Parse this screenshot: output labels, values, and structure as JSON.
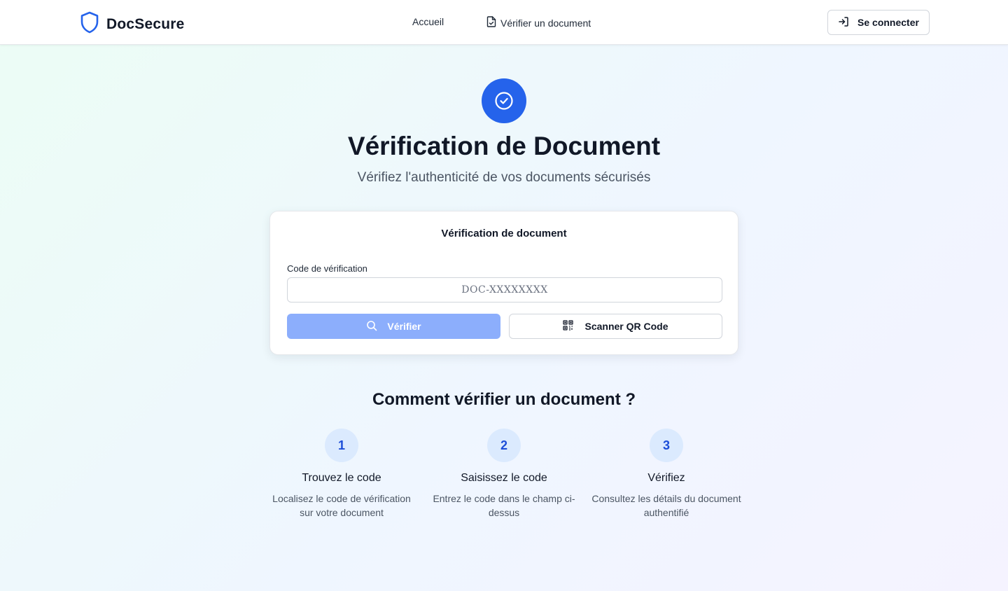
{
  "header": {
    "brand": "DocSecure",
    "nav": {
      "home": "Accueil",
      "verify": "Vérifier un document"
    },
    "login": "Se connecter"
  },
  "hero": {
    "title": "Vérification de Document",
    "subtitle": "Vérifiez l'authenticité de vos documents sécurisés"
  },
  "card": {
    "title": "Vérification de document",
    "code_label": "Code de vérification",
    "code_placeholder": "DOC-XXXXXXXX",
    "code_value": "",
    "verify_button": "Vérifier",
    "scan_button": "Scanner QR Code"
  },
  "how_to": {
    "title": "Comment vérifier un document ?",
    "steps": [
      {
        "number": "1",
        "title": "Trouvez le code",
        "description": "Localisez le code de vérification sur votre document"
      },
      {
        "number": "2",
        "title": "Saisissez le code",
        "description": "Entrez le code dans le champ ci-dessus"
      },
      {
        "number": "3",
        "title": "Vérifiez",
        "description": "Consultez les détails du document authentifié"
      }
    ]
  },
  "colors": {
    "primary": "#2563eb",
    "primary_disabled": "#8caefc",
    "step_bg": "#dbeafe"
  },
  "icons": {
    "brand": "shield-icon",
    "nav_verify": "file-check-icon",
    "login": "log-in-icon",
    "hero": "check-circle-icon",
    "verify": "search-icon",
    "scan": "qr-code-icon"
  }
}
